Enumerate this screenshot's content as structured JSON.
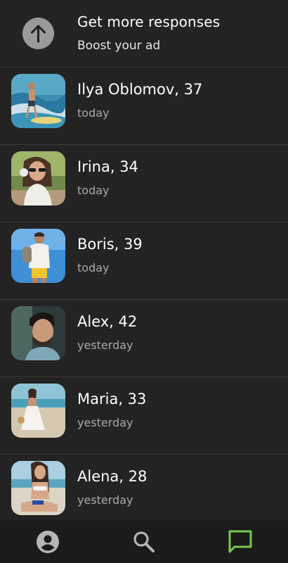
{
  "promo": {
    "title": "Get more responses",
    "subtitle": "Boost your ad",
    "icon": "arrow-up-icon"
  },
  "responses": [
    {
      "name": "Ilya Oblomov, 37",
      "when": "today"
    },
    {
      "name": "Irina, 34",
      "when": "today"
    },
    {
      "name": "Boris, 39",
      "when": "today"
    },
    {
      "name": "Alex, 42",
      "when": "yesterday"
    },
    {
      "name": "Maria, 33",
      "when": "yesterday"
    },
    {
      "name": "Alena, 28",
      "when": "yesterday"
    }
  ],
  "tabs": [
    {
      "icon": "profile-icon",
      "active": false
    },
    {
      "icon": "search-icon",
      "active": false
    },
    {
      "icon": "messages-icon",
      "active": true
    }
  ],
  "colors": {
    "background": "#232323",
    "tabbar": "#1b1b1b",
    "active_tab": "#7ac74f",
    "inactive_tab": "#b5b5b5",
    "secondary_text": "#a8a8a8"
  }
}
